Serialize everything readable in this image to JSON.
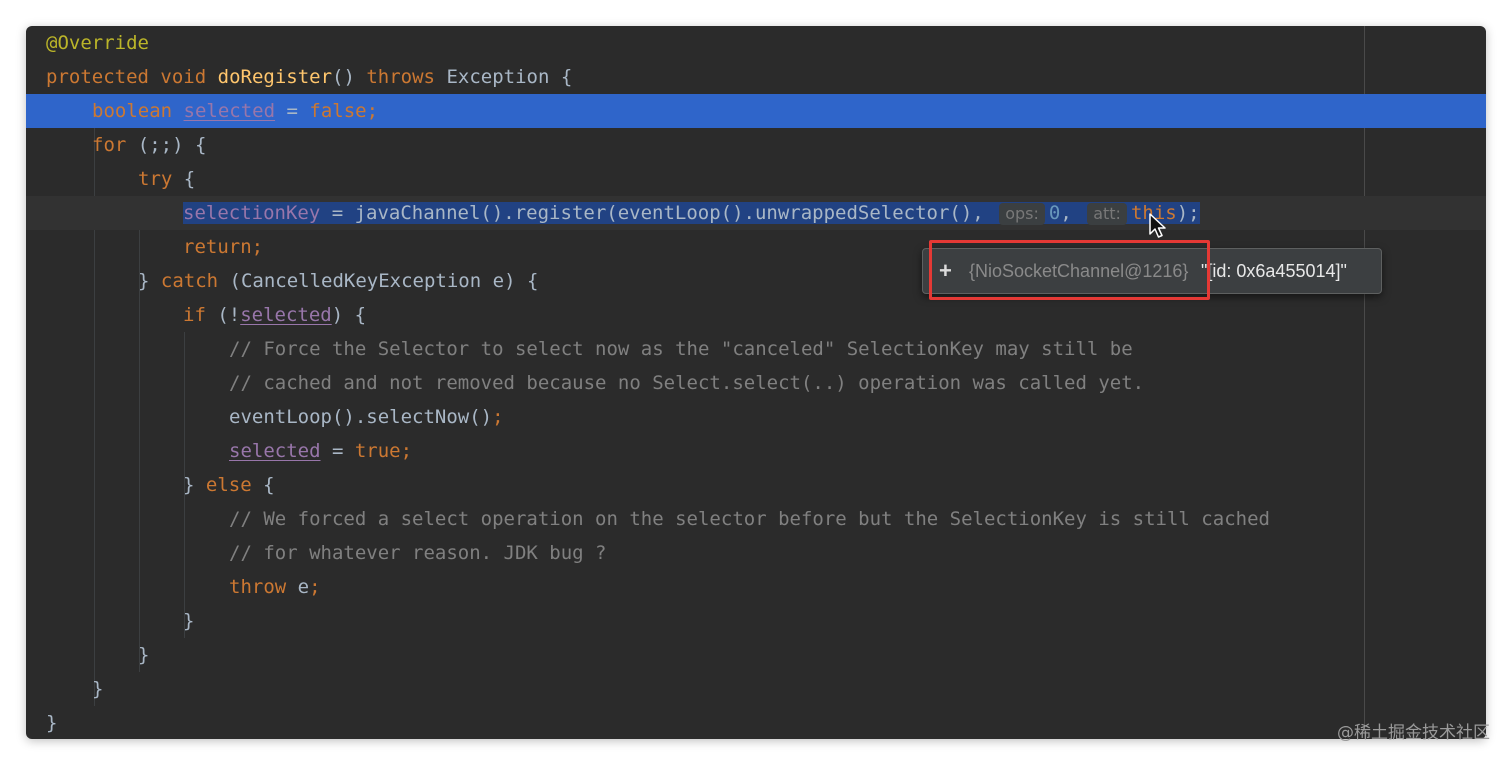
{
  "code": {
    "l1": {
      "annotation": "@Override"
    },
    "l2": {
      "protected": "protected",
      "void": "void",
      "method": "doRegister",
      "params": "()",
      "throws": "throws",
      "exception": "Exception",
      "brace": " {"
    },
    "l3": {
      "type": "boolean",
      "var": "selected",
      "eq": " = ",
      "value": "false",
      "semi": ";"
    },
    "l4": {
      "kw": "for",
      "rest": " (;;) {"
    },
    "l5": {
      "kw": "try",
      "rest": " {"
    },
    "l6": {
      "var": "selectionKey",
      "call": " = javaChannel().register(eventLoop().unwrappedSelector(), ",
      "hint_ops": "ops:",
      "ops_value": "0",
      "comma": ", ",
      "hint_att": "att:",
      "att_value": "this",
      "end": ");"
    },
    "l7": {
      "kw": "return",
      "semi": ";"
    },
    "l8": {
      "close": "} ",
      "kw": "catch",
      "rest": " (CancelledKeyException e) {"
    },
    "l9": {
      "kw": "if",
      "open": " (!",
      "var": "selected",
      "rest": ") {"
    },
    "l10": {
      "comment": "// Force the Selector to select now as the \"canceled\" SelectionKey may still be"
    },
    "l11": {
      "comment": "// cached and not removed because no Select.select(..) operation was called yet."
    },
    "l12": {
      "text": "eventLoop().selectNow()",
      "semi": ";"
    },
    "l13": {
      "var": "selected",
      "eq": " = ",
      "value": "true",
      "semi": ";"
    },
    "l14": {
      "close": "} ",
      "kw": "else",
      "rest": " {"
    },
    "l15": {
      "comment": "// We forced a select operation on the selector before but the SelectionKey is still cached"
    },
    "l16": {
      "comment": "// for whatever reason. JDK bug ?"
    },
    "l17": {
      "kw": "throw",
      "rest": " e",
      "semi": ";"
    },
    "l18": {
      "text": "}"
    },
    "l19": {
      "text": "}"
    },
    "l20": {
      "text": "}"
    },
    "l21": {
      "text": "}"
    }
  },
  "tooltip": {
    "expand": "+",
    "ref": "{NioSocketChannel@1216}",
    "value": "\"[id: 0x6a455014]\""
  },
  "watermark": "@稀土掘金技术社区",
  "colors": {
    "editor_bg": "#2b2b2b",
    "keyword": "#cc7832",
    "annotation": "#bbb529",
    "method": "#ffc66d",
    "field": "#9876aa",
    "number": "#6897bb",
    "comment": "#808080",
    "line_highlight": "#2f65ca",
    "selection": "#214283",
    "callout": "#e53935"
  }
}
